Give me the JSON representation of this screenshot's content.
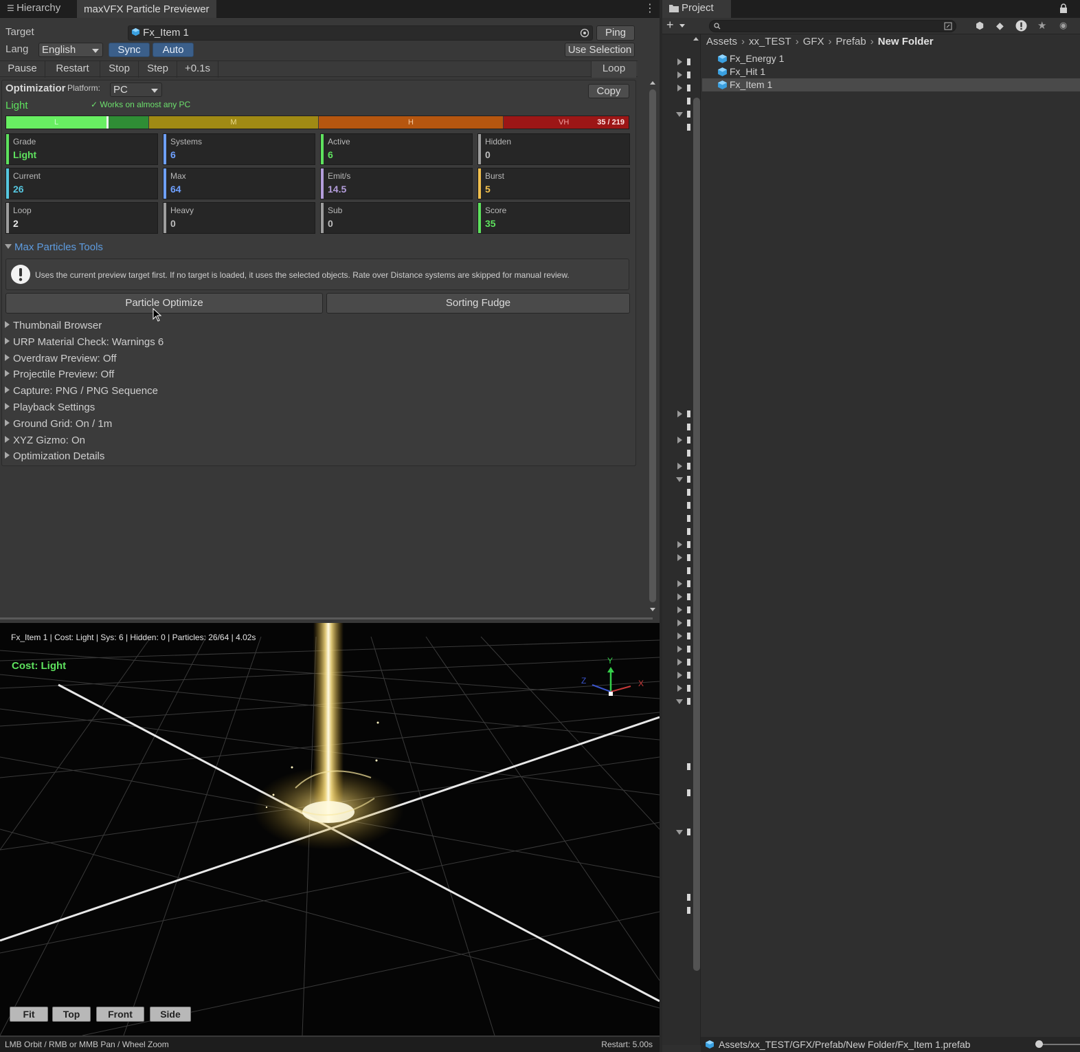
{
  "tabs": {
    "hierarchy": "Hierarchy",
    "previewer": "maxVFX Particle Previewer",
    "project": "Project"
  },
  "target": {
    "label": "Target",
    "value": "Fx_Item 1",
    "ping": "Ping"
  },
  "lang": {
    "label": "Lang",
    "value": "English",
    "sync": "Sync",
    "auto": "Auto",
    "use_selection": "Use Selection"
  },
  "playback": {
    "pause": "Pause",
    "restart": "Restart",
    "stop": "Stop",
    "step": "Step",
    "plus": "+0.1s",
    "loop": "Loop"
  },
  "optimization": {
    "title": "Optimizatior",
    "platform_label": "Platform:",
    "platform_value": "PC",
    "copy": "Copy",
    "grade": "Light",
    "note": "✓ Works on almost any PC",
    "bar": {
      "l": "L",
      "m": "M",
      "h": "H",
      "vh": "VH",
      "score_text": "35 / 219",
      "score": 35,
      "max": 219
    },
    "stats": [
      {
        "key": "Grade",
        "value": "Light"
      },
      {
        "key": "Systems",
        "value": "6"
      },
      {
        "key": "Active",
        "value": "6"
      },
      {
        "key": "Hidden",
        "value": "0"
      },
      {
        "key": "Current",
        "value": "26"
      },
      {
        "key": "Max",
        "value": "64"
      },
      {
        "key": "Emit/s",
        "value": "14.5"
      },
      {
        "key": "Burst",
        "value": "5"
      },
      {
        "key": "Loop",
        "value": "2"
      },
      {
        "key": "Heavy",
        "value": "0"
      },
      {
        "key": "Sub",
        "value": "0"
      },
      {
        "key": "Score",
        "value": "35"
      }
    ],
    "colors": {
      "green": "#5ee25e",
      "blue": "#6ea0ff",
      "purple": "#b39ddb",
      "yellow": "#f2c14e",
      "gray": "#9e9e9e",
      "cyan": "#56c7e0"
    }
  },
  "max_particles": {
    "title": "Max Particles Tools",
    "info": "Uses the current preview target first. If no target is loaded, it uses the selected objects. Rate over Distance systems are skipped for manual review.",
    "particle_optimize": "Particle Optimize",
    "sorting_fudge": "Sorting Fudge"
  },
  "foldouts": [
    "Thumbnail Browser",
    "URP Material Check: Warnings 6",
    "Overdraw Preview: Off",
    "Projectile Preview: Off",
    "Capture: PNG / PNG Sequence",
    "Playback Settings",
    "Ground Grid: On / 1m",
    "XYZ Gizmo: On",
    "Optimization Details"
  ],
  "viewport": {
    "info": "Fx_Item 1 | Cost: Light | Sys: 6 | Hidden: 0 | Particles: 26/64 | 4.02s",
    "cost": "Cost: Light",
    "axis_x": "X",
    "axis_y": "Y",
    "axis_z": "Z",
    "buttons": [
      "Fit",
      "Top",
      "Front",
      "Side"
    ],
    "controls_hint": "LMB Orbit / RMB or MMB Pan / Wheel Zoom",
    "restart": "Restart: 5.00s"
  },
  "project": {
    "breadcrumb": [
      "Assets",
      "xx_TEST",
      "GFX",
      "Prefab",
      "New Folder"
    ],
    "items": [
      "Fx_Energy 1",
      "Fx_Hit 1",
      "Fx_Item 1"
    ],
    "selected": "Fx_Item 1",
    "footer_path": "Assets/xx_TEST/GFX/Prefab/New Folder/Fx_Item 1.prefab"
  }
}
